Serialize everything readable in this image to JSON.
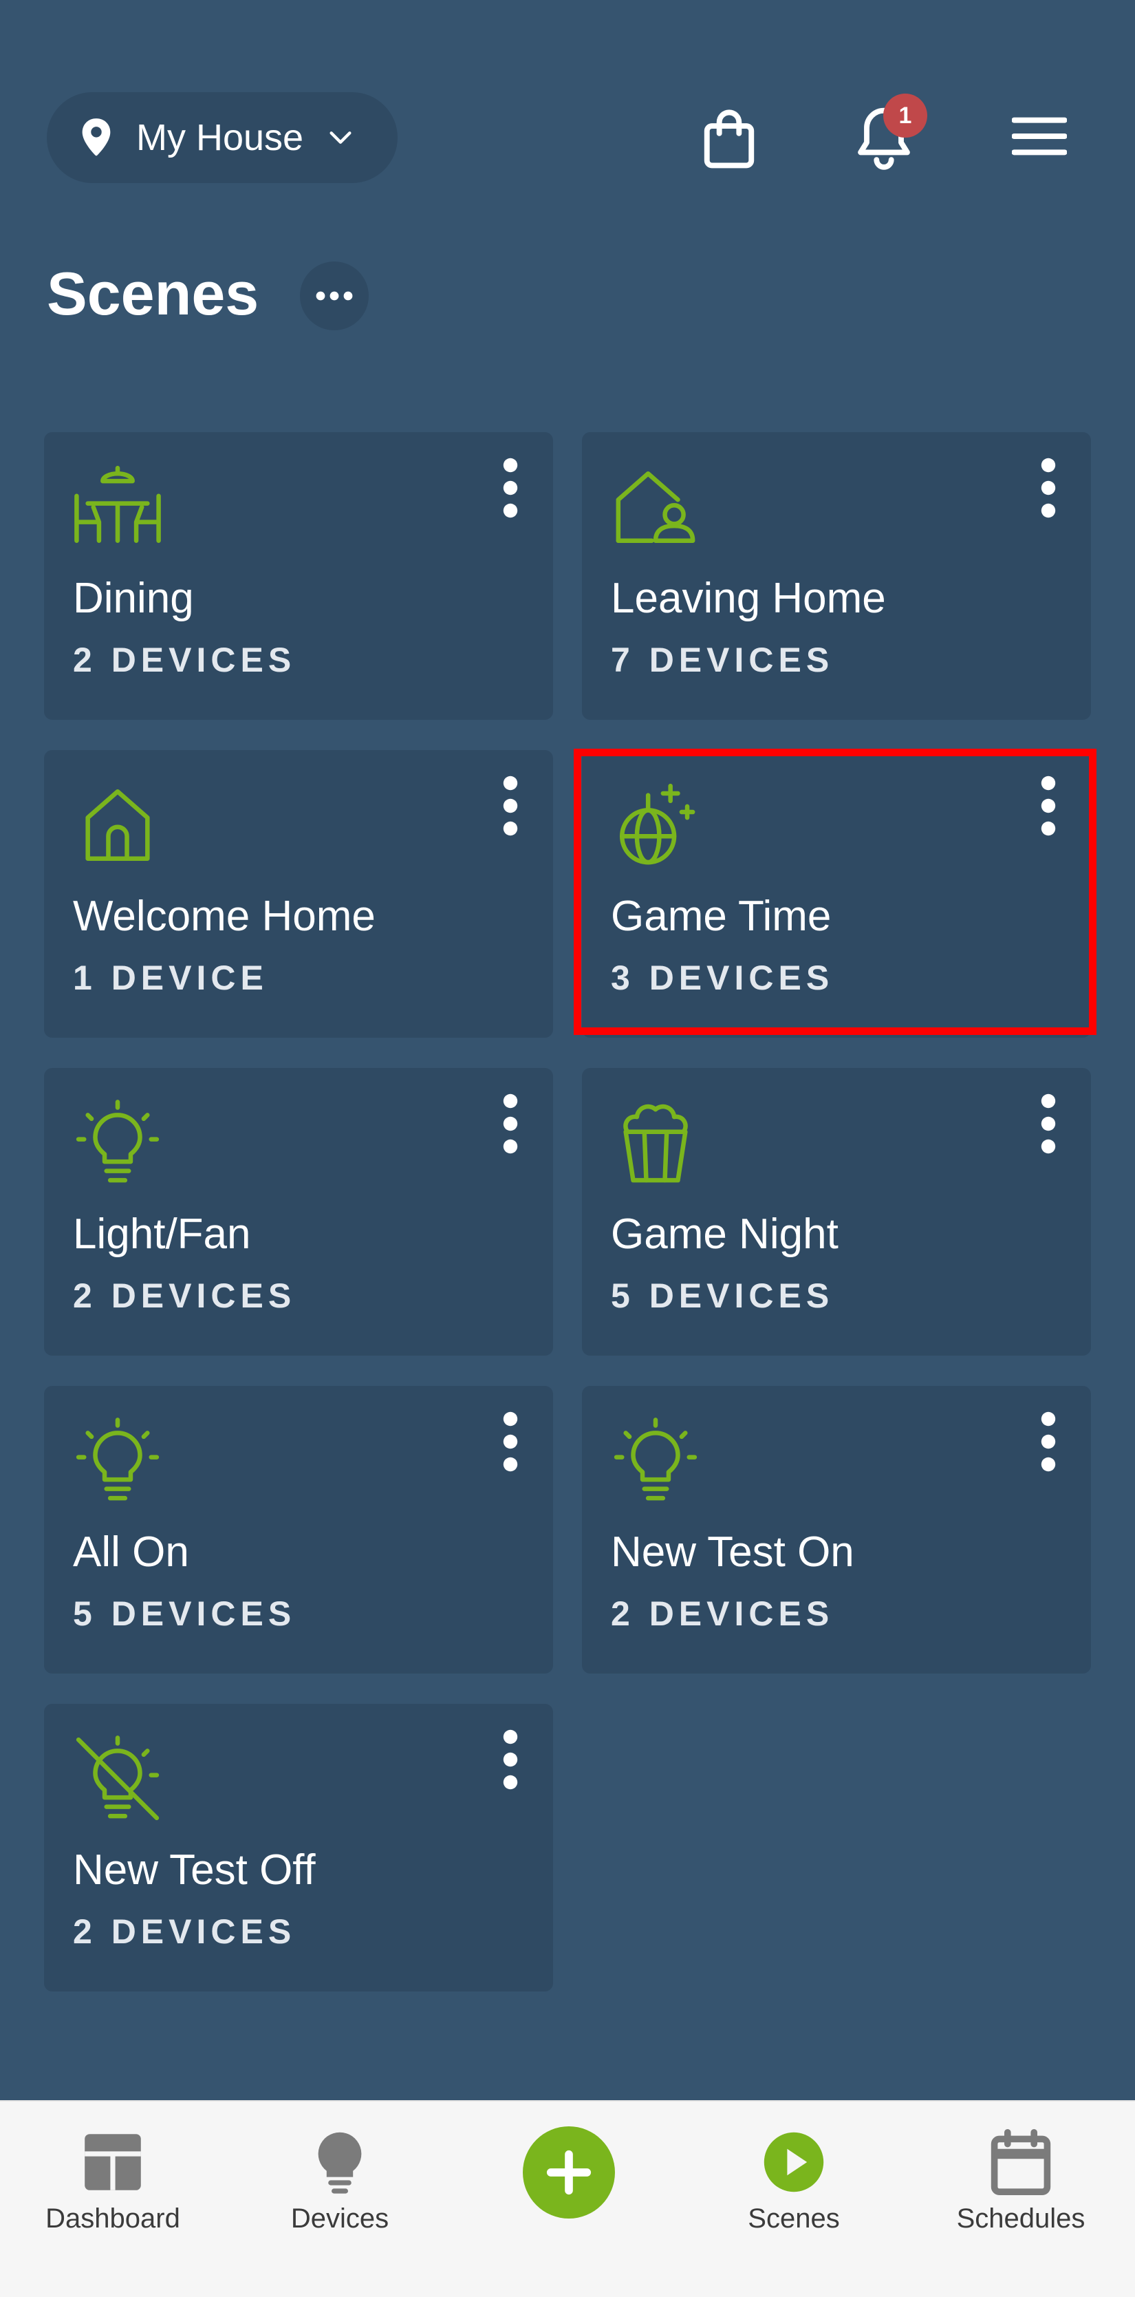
{
  "header": {
    "location_label": "My House",
    "location_icon": "map-pin-icon",
    "notification_count": "1",
    "page_title": "Scenes"
  },
  "colors": {
    "background": "#36546f",
    "card": "#2f4a63",
    "accent_green": "#7ab51d",
    "badge_red": "#c0484a",
    "highlight": "#ff0000",
    "nav_background": "#f6f6f6"
  },
  "scenes": [
    {
      "name": "Dining",
      "count": "2 DEVICES",
      "icon": "dining-table-icon"
    },
    {
      "name": "Leaving Home",
      "count": "7 DEVICES",
      "icon": "home-person-icon"
    },
    {
      "name": "Welcome Home",
      "count": "1 DEVICE",
      "icon": "home-icon"
    },
    {
      "name": "Game Time",
      "count": "3 DEVICES",
      "icon": "disco-ball-icon"
    },
    {
      "name": "Light/Fan",
      "count": "2 DEVICES",
      "icon": "lightbulb-icon"
    },
    {
      "name": "Game Night",
      "count": "5 DEVICES",
      "icon": "popcorn-icon"
    },
    {
      "name": "All On",
      "count": "5 DEVICES",
      "icon": "lightbulb-icon"
    },
    {
      "name": "New Test On",
      "count": "2 DEVICES",
      "icon": "lightbulb-icon"
    },
    {
      "name": "New Test Off",
      "count": "2 DEVICES",
      "icon": "lightbulb-off-icon"
    }
  ],
  "bottom_nav": {
    "dashboard": "Dashboard",
    "devices": "Devices",
    "scenes": "Scenes",
    "schedules": "Schedules",
    "active": "scenes"
  }
}
